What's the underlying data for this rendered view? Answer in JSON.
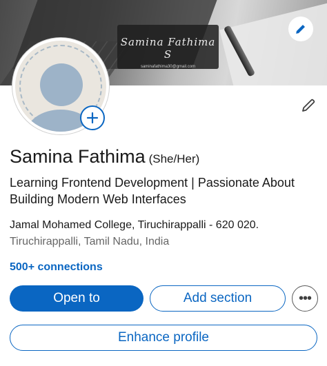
{
  "banner": {
    "signature_name": "Samina Fathima S",
    "signature_email": "saminafathima30@gmail.com"
  },
  "profile": {
    "name": "Samina Fathima",
    "pronouns": "(She/Her)",
    "headline": "Learning Frontend Development | Passionate About Building Modern Web Interfaces",
    "education": "Jamal Mohamed College, Tiruchirappalli - 620 020.",
    "location": "Tiruchirappalli, Tamil Nadu, India",
    "connections": "500+ connections"
  },
  "actions": {
    "open_to": "Open to",
    "add_section": "Add section",
    "more_glyph": "•••",
    "enhance_profile": "Enhance profile"
  },
  "icons": {
    "edit_banner": "pencil-icon",
    "edit_intro": "pencil-icon",
    "add_photo": "plus-icon",
    "more": "ellipsis-icon"
  },
  "colors": {
    "brand_blue": "#0a66c2",
    "avatar_fill": "#9db3c8"
  }
}
